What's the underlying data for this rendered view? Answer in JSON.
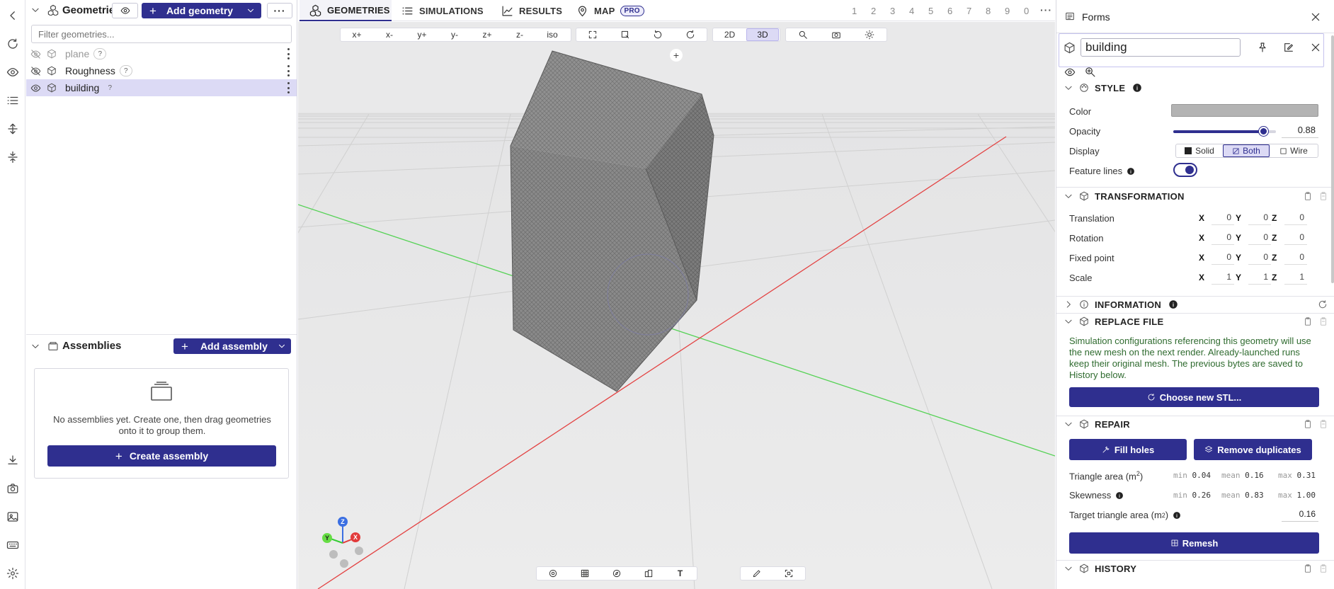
{
  "sidebar": {
    "items": [
      "back",
      "refresh",
      "visibility",
      "list",
      "expand",
      "collapse",
      "download",
      "camera",
      "image",
      "keyboard",
      "settings"
    ]
  },
  "geometries": {
    "title": "Geometries",
    "add_label": "Add geometry",
    "filter_placeholder": "Filter geometries...",
    "items": [
      {
        "label": "plane",
        "badge": "?",
        "hidden": true
      },
      {
        "label": "Roughness",
        "badge": "?",
        "hidden": false
      },
      {
        "label": "building",
        "badge": "?",
        "hidden": false,
        "selected": true
      }
    ]
  },
  "assemblies": {
    "title": "Assemblies",
    "add_label": "Add assembly",
    "empty_text": "No assemblies yet. Create one, then drag geometries onto it to group them.",
    "create_label": "Create assembly"
  },
  "tabs": {
    "geometries": "GEOMETRIES",
    "simulations": "SIMULATIONS",
    "results": "RESULTS",
    "map": "MAP",
    "pro": "PRO",
    "numbers": [
      "1",
      "2",
      "3",
      "4",
      "5",
      "6",
      "7",
      "8",
      "9",
      "0"
    ]
  },
  "viewport": {
    "view_buttons": [
      "x+",
      "x-",
      "y+",
      "y-",
      "z+",
      "z-",
      "iso"
    ],
    "mode_2d": "2D",
    "mode_3d": "3D",
    "active_mode": "3D",
    "plus": "+",
    "axes": {
      "x": "X",
      "y": "Y",
      "z": "Z"
    },
    "bottom_text_tool": "T"
  },
  "forms": {
    "title": "Forms",
    "name_value": "building",
    "style": {
      "title": "STYLE",
      "color_label": "Color",
      "color_value": "#b3b3b3",
      "opacity_label": "Opacity",
      "opacity_value": "0.88",
      "opacity": 0.88,
      "display_label": "Display",
      "display_options": [
        "Solid",
        "Both",
        "Wire"
      ],
      "display_selected": "Both",
      "feature_lines_label": "Feature lines",
      "feature_lines_on": true
    },
    "transformation": {
      "title": "TRANSFORMATION",
      "rows": [
        {
          "label": "Translation",
          "x": "0",
          "y": "0",
          "z": "0"
        },
        {
          "label": "Rotation",
          "x": "0",
          "y": "0",
          "z": "0"
        },
        {
          "label": "Fixed point",
          "x": "0",
          "y": "0",
          "z": "0"
        },
        {
          "label": "Scale",
          "x": "1",
          "y": "1",
          "z": "1"
        }
      ]
    },
    "information": {
      "title": "INFORMATION"
    },
    "replace_file": {
      "title": "REPLACE FILE",
      "text": "Simulation configurations referencing this geometry will use the new mesh on the next render. Already-launched runs keep their original mesh. The previous bytes are saved to History below.",
      "button": "Choose new STL..."
    },
    "repair": {
      "title": "REPAIR",
      "fill_holes": "Fill holes",
      "remove_duplicates": "Remove duplicates",
      "triangle_area_label": "Triangle area (m",
      "triangle_area_sup": "2",
      "triangle_area_close": ")",
      "triangle_area": {
        "min": "0.04",
        "mean": "0.16",
        "max": "0.31"
      },
      "skewness_label": "Skewness",
      "skewness": {
        "min": "0.26",
        "mean": "0.83",
        "max": "1.00"
      },
      "min_label": "min",
      "mean_label": "mean",
      "max_label": "max",
      "target_label": "Target triangle area (m",
      "target_sup": "2",
      "target_close": ")",
      "target_value": "0.16",
      "remesh": "Remesh"
    },
    "history": {
      "title": "HISTORY"
    }
  },
  "colors": {
    "accent": "#2f2f8f",
    "selected_row": "#dcdaf5",
    "viewport_bg": "#e9e9ea",
    "x_axis": "#e23b3b",
    "y_axis": "#33cc33",
    "z_axis": "#3b6fe2"
  }
}
